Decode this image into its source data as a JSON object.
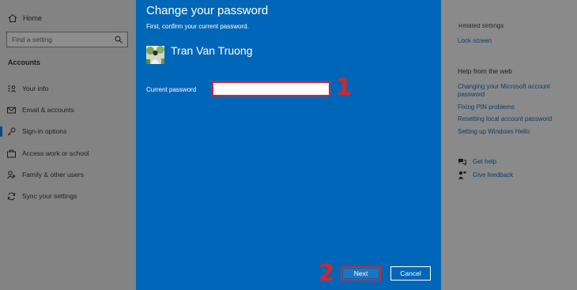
{
  "nav": {
    "home_label": "Home",
    "search_placeholder": "Find a setting",
    "section_title": "Accounts",
    "items": [
      {
        "label": "Your info",
        "icon": "person-card-icon"
      },
      {
        "label": "Email & accounts",
        "icon": "mail-icon"
      },
      {
        "label": "Sign-in options",
        "icon": "key-icon",
        "selected": true
      },
      {
        "label": "Access work or school",
        "icon": "briefcase-icon"
      },
      {
        "label": "Family & other users",
        "icon": "person-add-icon"
      },
      {
        "label": "Sync your settings",
        "icon": "sync-icon"
      }
    ]
  },
  "right": {
    "related_settings_cut": "Related settings",
    "lock_screen": "Lock screen",
    "help_title": "Help from the web",
    "links": [
      "Changing your Microsoft account password",
      "Fixing PIN problems",
      "Resetting local account password",
      "Setting up Windows Hello"
    ],
    "get_help": "Get help",
    "give_feedback": "Give feedback"
  },
  "dialog": {
    "title": "Change your password",
    "subtitle": "First, confirm your current password.",
    "user_name": "Tran Van Truong",
    "current_password_label": "Current password",
    "current_password_value": "",
    "next_label": "Next",
    "cancel_label": "Cancel"
  },
  "annotations": {
    "step1": "1",
    "step2": "2"
  },
  "colors": {
    "dialog_bg": "#0067b8",
    "highlight_red": "#d6262b",
    "dimmed_bg": "#8a8a8a"
  }
}
